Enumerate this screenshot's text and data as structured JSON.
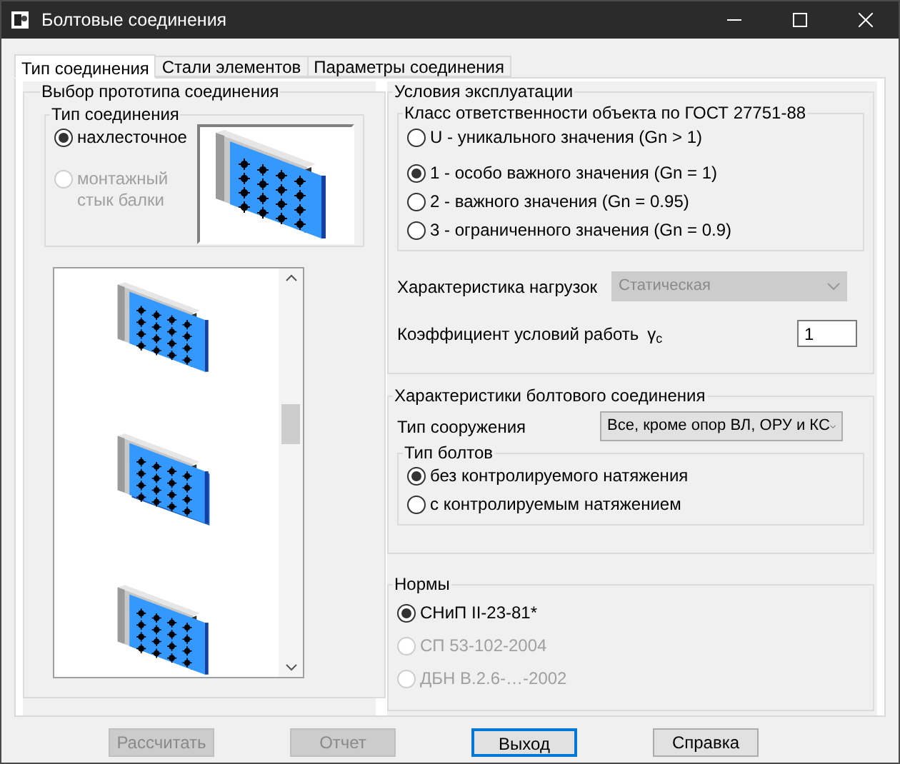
{
  "window": {
    "title": "Болтовые соединения"
  },
  "tabs": [
    {
      "label": "Тип соединения",
      "selected": true
    },
    {
      "label": "Стали элементов",
      "selected": false
    },
    {
      "label": "Параметры соединения",
      "selected": false
    }
  ],
  "prototype": {
    "title": "Выбор прототипа соединения",
    "connection_type": {
      "title": "Тип соединения",
      "options": [
        {
          "label": "нахлесточное",
          "selected": true,
          "disabled": false
        },
        {
          "label": "монтажный стык балки",
          "selected": false,
          "disabled": true
        }
      ]
    }
  },
  "conditions": {
    "title": "Условия эксплуатации",
    "class_group": {
      "title": "Класс ответственности объекта по ГОСТ 27751-88",
      "options": [
        {
          "label": "U - уникального значения (Gn > 1)",
          "selected": false
        },
        {
          "label": "1 - особо важного значения (Gn = 1)",
          "selected": true
        },
        {
          "label": "2 - важного значения (Gn = 0.95)",
          "selected": false
        },
        {
          "label": "3 - ограниченного значения (Gn = 0.9)",
          "selected": false
        }
      ]
    },
    "load": {
      "label": "Характеристика нагрузок",
      "value": "Статическая",
      "disabled": true
    },
    "coefficient": {
      "label": "Коэффициент условий работь",
      "symbol": "γ$_{c}$",
      "value": "1"
    }
  },
  "bolted": {
    "title": "Характеристики болтового соединения",
    "structure": {
      "label": "Тип сооружения",
      "value": "Все, кроме опор ВЛ, ОРУ и КС",
      "disabled": false
    },
    "bolt_type": {
      "title": "Тип болтов",
      "options": [
        {
          "label": "без контролируемого натяжения",
          "selected": true
        },
        {
          "label": "с контролируемым натяжением",
          "selected": false
        }
      ]
    }
  },
  "norms": {
    "title": "Нормы",
    "options": [
      {
        "label": "СНиП II-23-81*",
        "selected": true,
        "disabled": false
      },
      {
        "label": "СП 53-102-2004",
        "selected": false,
        "disabled": true
      },
      {
        "label": "ДБН В.2.6-…-2002",
        "selected": false,
        "disabled": true
      }
    ]
  },
  "buttons": [
    {
      "label": "Рассчитать",
      "disabled": true,
      "default": false
    },
    {
      "label": "Отчет",
      "disabled": true,
      "default": false
    },
    {
      "label": "Выход",
      "disabled": false,
      "default": true
    },
    {
      "label": "Справка",
      "disabled": false,
      "default": false
    }
  ]
}
